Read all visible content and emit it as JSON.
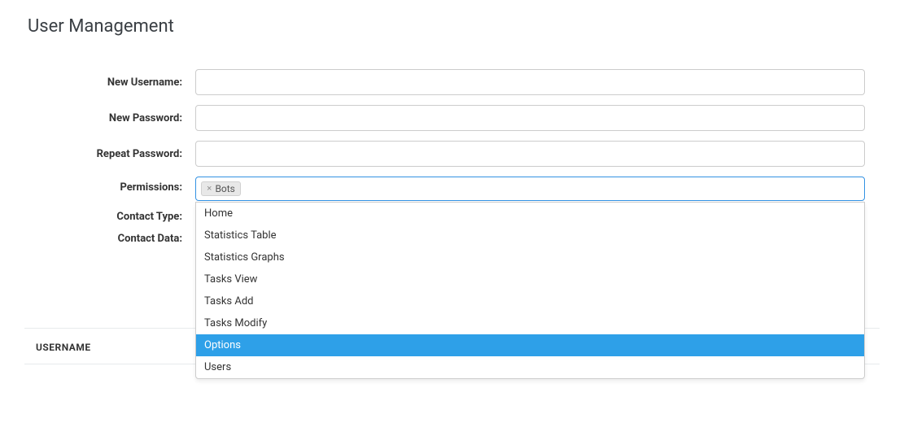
{
  "page": {
    "title": "User Management"
  },
  "form": {
    "labels": {
      "new_username": "New Username:",
      "new_password": "New Password:",
      "repeat_password": "Repeat Password:",
      "permissions": "Permissions:",
      "contact_type": "Contact Type:",
      "contact_data": "Contact Data:"
    },
    "values": {
      "new_username": "",
      "new_password": "",
      "repeat_password": "",
      "contact_data": ""
    },
    "permissions": {
      "selected": [
        {
          "label": "Bots"
        }
      ],
      "options": [
        {
          "label": "Home",
          "highlighted": false
        },
        {
          "label": "Statistics Table",
          "highlighted": false
        },
        {
          "label": "Statistics Graphs",
          "highlighted": false
        },
        {
          "label": "Tasks View",
          "highlighted": false
        },
        {
          "label": "Tasks Add",
          "highlighted": false
        },
        {
          "label": "Tasks Modify",
          "highlighted": false
        },
        {
          "label": "Options",
          "highlighted": true
        },
        {
          "label": "Users",
          "highlighted": false
        }
      ]
    }
  },
  "table": {
    "columns": {
      "username": "USERNAME"
    }
  }
}
